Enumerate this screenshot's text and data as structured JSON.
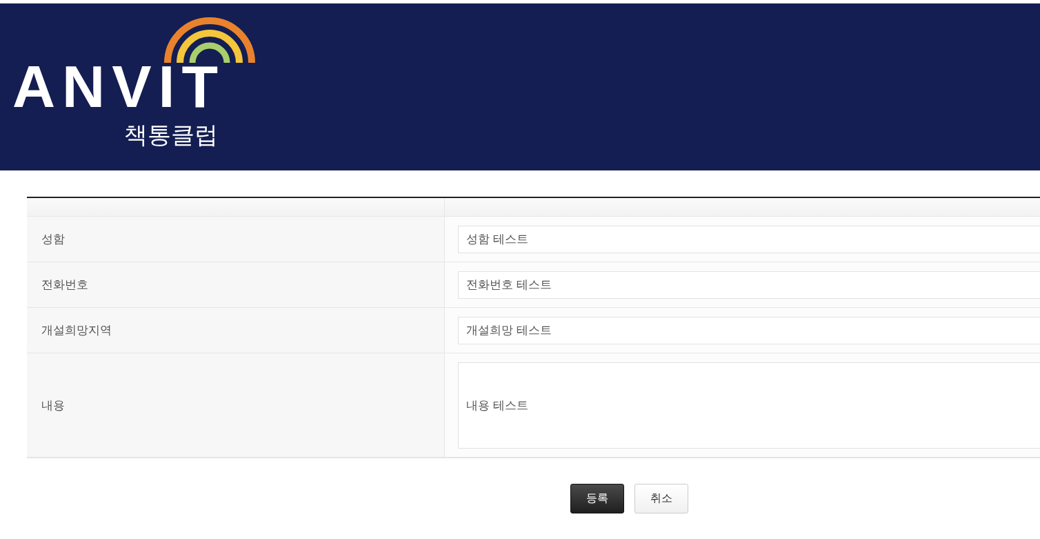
{
  "header": {
    "wordmark": "ANVIT",
    "subtitle": "책통클럽"
  },
  "form": {
    "rows": [
      {
        "label": "성함",
        "value": "성함 테스트",
        "kind": "input"
      },
      {
        "label": "전화번호",
        "value": "전화번호 테스트",
        "kind": "input"
      },
      {
        "label": "개설희망지역",
        "value": "개설희망 테스트",
        "kind": "input"
      },
      {
        "label": "내용",
        "value": "내용 테스트",
        "kind": "textarea"
      }
    ]
  },
  "buttons": [
    {
      "label": "등록",
      "kind": "primary"
    },
    {
      "label": "취소",
      "kind": "secondary"
    }
  ]
}
